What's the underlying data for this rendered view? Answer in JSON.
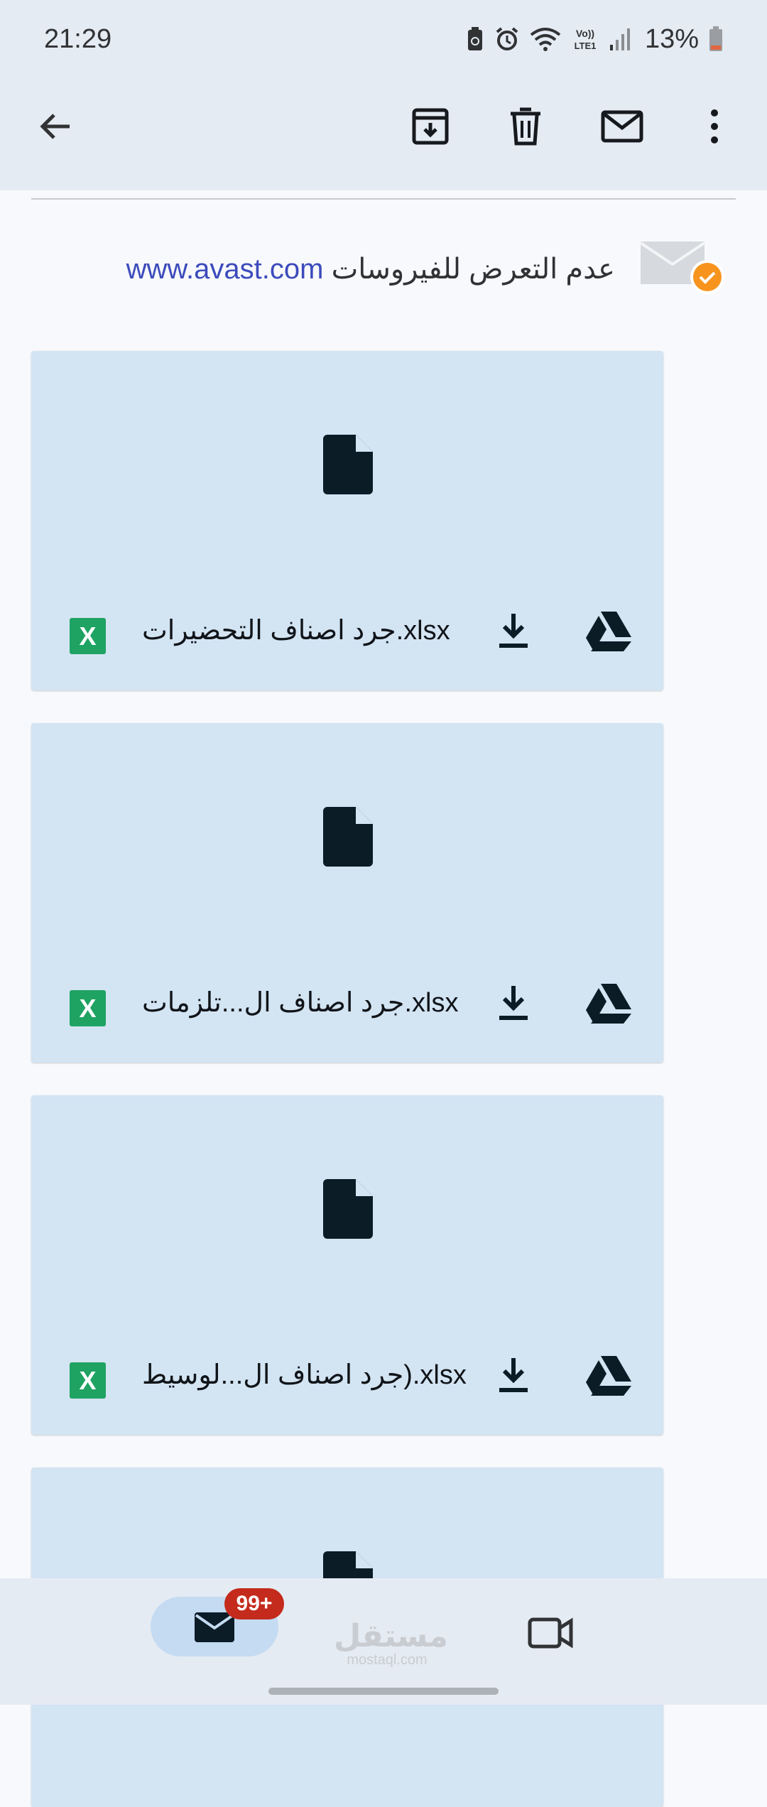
{
  "status_bar": {
    "time": "21:29",
    "battery_percent": "13%",
    "icons": [
      "battery-saver-icon",
      "alarm-icon",
      "wifi-icon",
      "volte-icon",
      "signal-icon",
      "battery-icon"
    ]
  },
  "toolbar": {
    "back_icon": "arrow-left-icon",
    "actions": [
      "archive-icon",
      "delete-icon",
      "mark-unread-icon",
      "more-vert-icon"
    ]
  },
  "signature": {
    "text": "عدم التعرض للفيروسات",
    "link": "www.avast.com"
  },
  "attachments": [
    {
      "name": "جرد اصناف التحضيرات.xlsx",
      "type_label": "X"
    },
    {
      "name": "جرد اصناف ال...تلزمات.xlsx",
      "type_label": "X"
    },
    {
      "name": "جرد اصناف ال...لوسيط).xlsx",
      "type_label": "X"
    },
    {
      "name": "",
      "type_label": ""
    }
  ],
  "bottom_nav": {
    "mail_badge": "99+",
    "watermark_ar": "مستقل",
    "watermark_en": "mostaql.com"
  },
  "colors": {
    "app_bar": "#e5ebf3",
    "card": "#d3e4f3",
    "link": "#3c4bbb",
    "excel": "#1ea362",
    "badge": "#c42b1c"
  }
}
